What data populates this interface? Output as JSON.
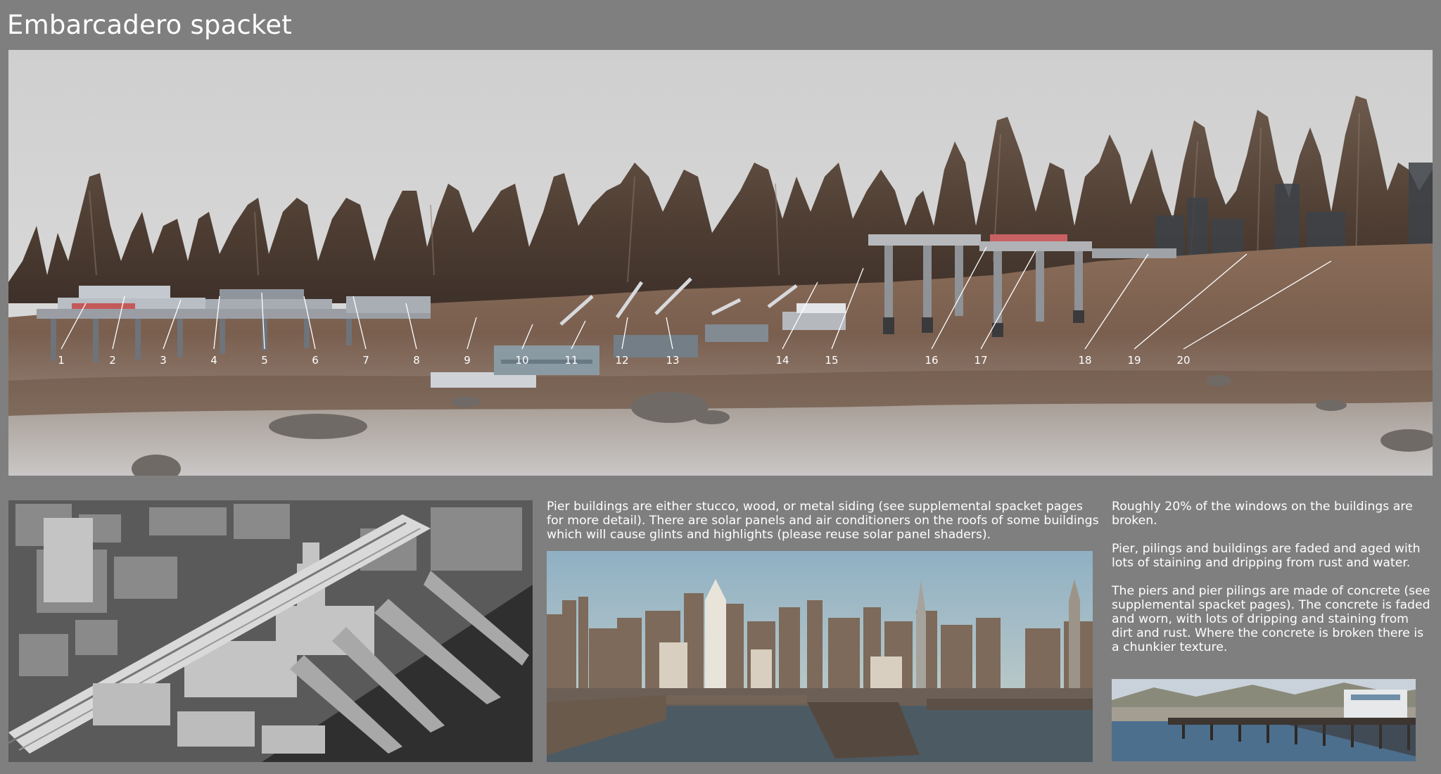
{
  "title": "Embarcadero spacket",
  "callouts": [
    "1",
    "2",
    "3",
    "4",
    "5",
    "6",
    "7",
    "8",
    "9",
    "10",
    "11",
    "12",
    "13",
    "14",
    "15",
    "16",
    "17",
    "18",
    "19",
    "20"
  ],
  "paragraphs": {
    "pier_buildings": "Pier buildings are either stucco, wood, or metal siding (see supplemental spacket pages for more detail).  There are solar panels and air conditioners on the roofs of some buildings which will cause glints and highlights (please reuse solar panel shaders).",
    "broken_windows": "Roughly 20% of the windows on the buildings are broken.",
    "faded": "Pier,   pilings and buildings are faded and aged with lots of staining and dripping from rust and water.",
    "concrete": "The piers and pier pilings are made of concrete (see supplemental spacket pages). The concrete is faded and worn, with lots of dripping and staining from dirt and rust.  Where the concrete is broken there is a chunkier texture."
  },
  "colors": {
    "background": "#7f7f7f",
    "text": "#ffffff",
    "sky": "#d7d7d7",
    "rock": "#5a4538",
    "ground": "#8a6f5c",
    "water": "#4c5a63"
  }
}
